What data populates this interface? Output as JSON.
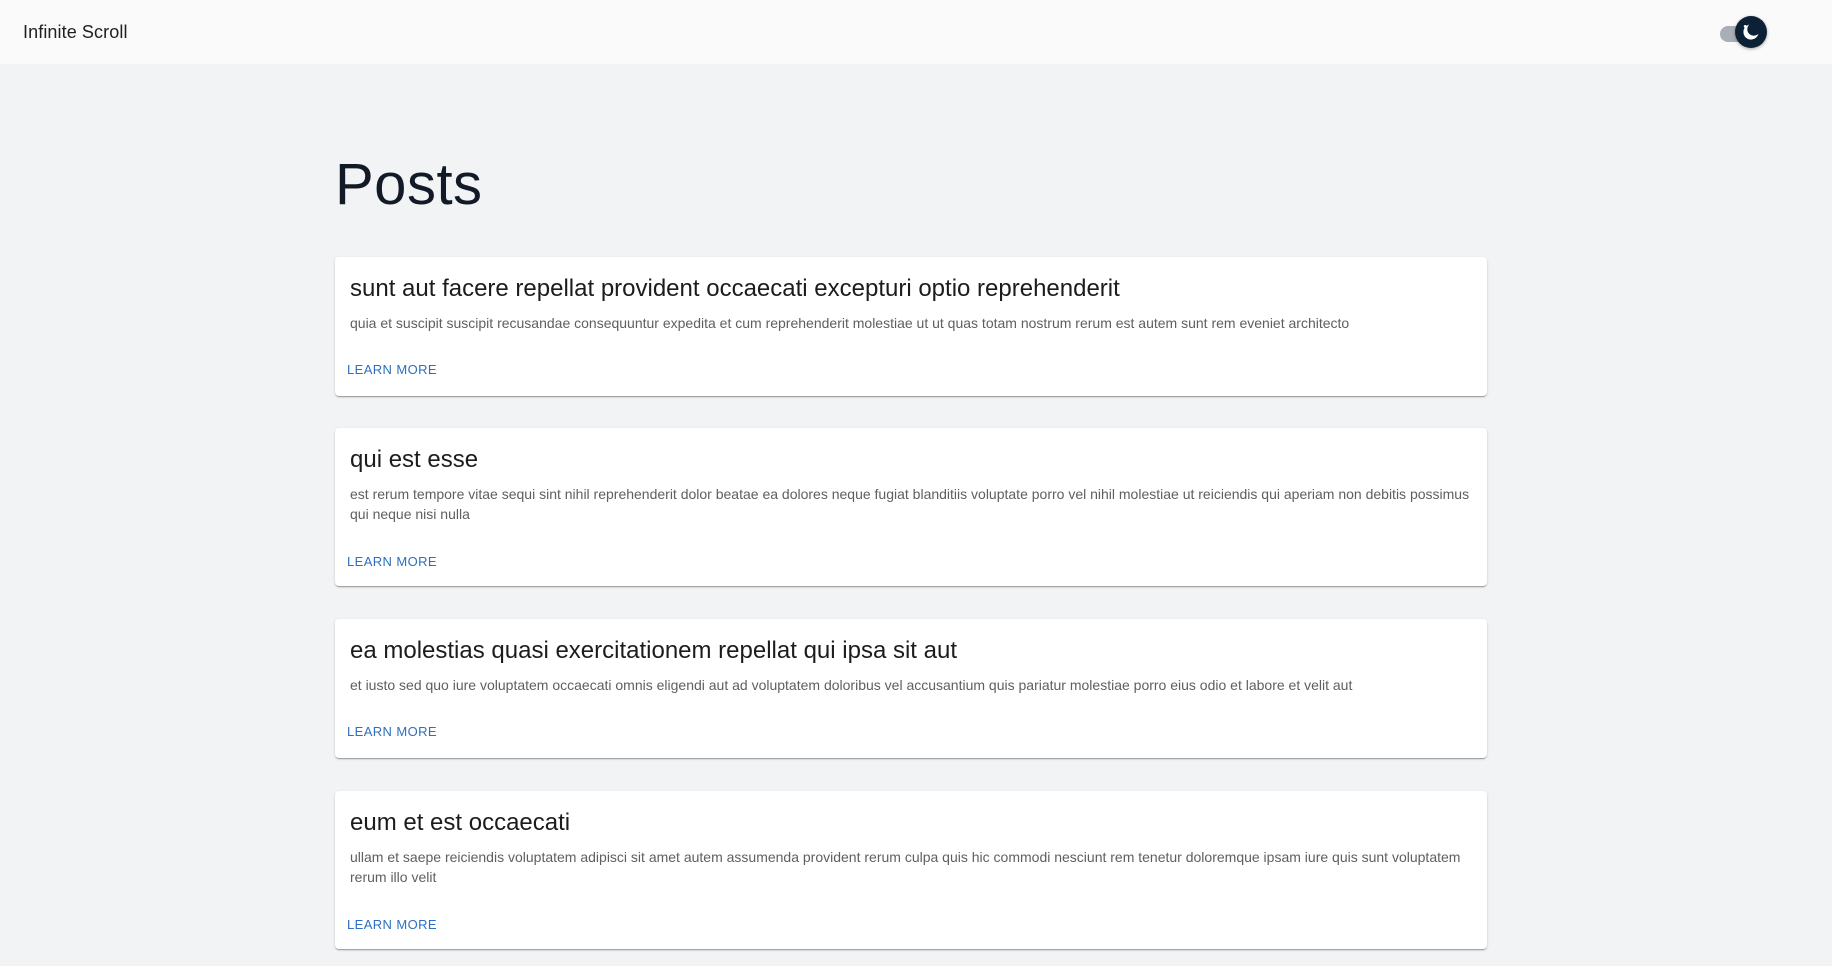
{
  "header": {
    "app_title": "Infinite Scroll",
    "theme_toggle": {
      "mode": "dark",
      "icon": "moon-icon",
      "checked": true
    }
  },
  "main": {
    "page_title": "Posts",
    "posts": [
      {
        "title": "sunt aut facere repellat provident occaecati excepturi optio reprehenderit",
        "body": "quia et suscipit suscipit recusandae consequuntur expedita et cum reprehenderit molestiae ut ut quas totam nostrum rerum est autem sunt rem eveniet architecto",
        "action_label": "LEARN MORE"
      },
      {
        "title": "qui est esse",
        "body": "est rerum tempore vitae sequi sint nihil reprehenderit dolor beatae ea dolores neque fugiat blanditiis voluptate porro vel nihil molestiae ut reiciendis qui aperiam non debitis possimus qui neque nisi nulla",
        "action_label": "LEARN MORE"
      },
      {
        "title": "ea molestias quasi exercitationem repellat qui ipsa sit aut",
        "body": "et iusto sed quo iure voluptatem occaecati omnis eligendi aut ad voluptatem doloribus vel accusantium quis pariatur molestiae porro eius odio et labore et velit aut",
        "action_label": "LEARN MORE"
      },
      {
        "title": "eum et est occaecati",
        "body": "ullam et saepe reiciendis voluptatem adipisci sit amet autem assumenda provident rerum culpa quis hic commodi nesciunt rem tenetur doloremque ipsam iure quis sunt voluptatem rerum illo velit",
        "action_label": "LEARN MORE"
      }
    ]
  },
  "colors": {
    "accent": "#2d6fc0",
    "page_background": "#f2f3f5",
    "topbar_background": "#fafafa",
    "toggle_thumb": "#0d2136"
  }
}
